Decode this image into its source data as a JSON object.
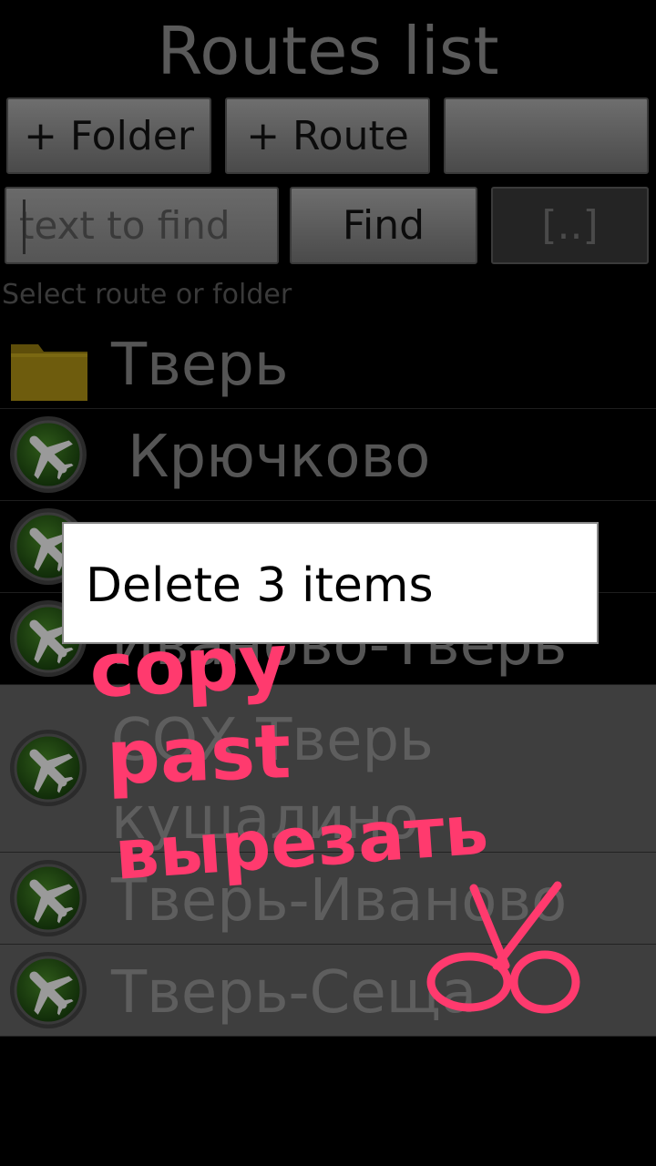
{
  "header": {
    "title": "Routes list"
  },
  "toolbar": {
    "add_folder": "+ Folder",
    "add_route": "+ Route",
    "blank": ""
  },
  "search": {
    "placeholder": "text to find",
    "find_label": "Find",
    "bracket_label": "[..]"
  },
  "list": {
    "hint": "Select route or folder",
    "items": [
      {
        "label": "Тверь",
        "type": "folder"
      },
      {
        "label": "Крючково",
        "type": "route"
      },
      {
        "label": "",
        "type": "route"
      },
      {
        "label": "Иваново-Тверь",
        "type": "route"
      },
      {
        "label": "СОХ Тверь кушалино",
        "type": "route",
        "selected": true
      },
      {
        "label": "Тверь-Иваново",
        "type": "route",
        "selected": true
      },
      {
        "label": "Тверь-Сеща",
        "type": "route",
        "selected": true
      }
    ]
  },
  "dialog": {
    "option": "Delete 3 items"
  },
  "annotations": {
    "line1": "copy",
    "line2": "past",
    "line3": "вырезать",
    "scissors_icon": "scissors-icon",
    "color": "#ff3a6e"
  }
}
